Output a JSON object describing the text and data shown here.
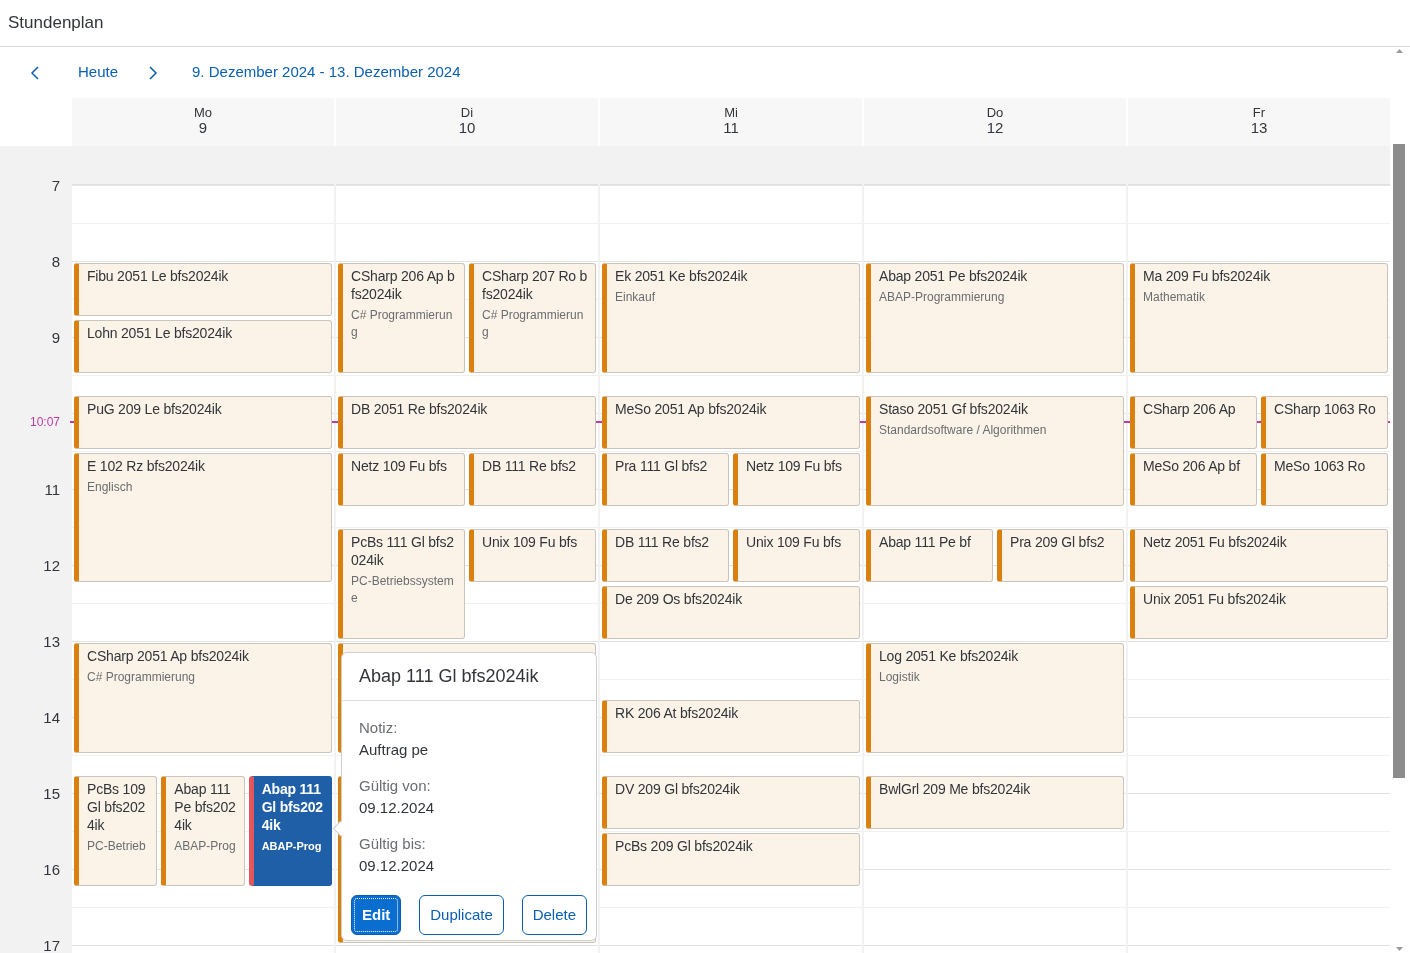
{
  "app": {
    "title": "Stundenplan"
  },
  "toolbar": {
    "today": "Heute",
    "range": "9. Dezember 2024 - 13. Dezember 2024"
  },
  "hours": [
    "7",
    "8",
    "9",
    "11",
    "12",
    "13",
    "14",
    "15",
    "16",
    "17"
  ],
  "now": {
    "label": "10:07"
  },
  "days": [
    {
      "weekday": "Mo",
      "date": "9",
      "groups": [
        {
          "items": [
            {
              "title": "Fibu 2051 Le bfs2024ik",
              "selected": false
            }
          ]
        },
        {
          "items": [
            {
              "title": "Lohn 2051 Le bfs2024ik",
              "selected": false
            }
          ]
        },
        {
          "items": [
            {
              "title": "PuG 209 Le bfs2024ik",
              "selected": false
            }
          ]
        },
        {
          "items": [
            {
              "title": "E 102 Rz bfs2024ik",
              "subtitle": "Englisch",
              "selected": false
            }
          ]
        },
        {
          "items": [
            {
              "title": "CSharp 2051 Ap bfs2024ik",
              "subtitle": "C# Programmierung",
              "selected": false
            }
          ]
        },
        {
          "items": [
            {
              "title": "PcBs 109 Gl bfs2024ik",
              "subtitle": "PC-Betrieb",
              "selected": false
            },
            {
              "title": "Abap 111 Pe bfs2024ik",
              "subtitle": "ABAP-Prog",
              "selected": false
            },
            {
              "title": "Abap 111 Gl bfs2024ik",
              "subtitle": "ABAP-Prog",
              "selected": true
            }
          ]
        }
      ]
    },
    {
      "weekday": "Di",
      "date": "10",
      "groups": [
        {
          "items": [
            {
              "title": "CSharp 206 Ap bfs2024ik",
              "subtitle": "C# Programmierung",
              "selected": false
            },
            {
              "title": "CSharp 207 Ro bfs2024ik",
              "subtitle": "C# Programmierung",
              "selected": false
            }
          ]
        },
        {
          "items": [
            {
              "title": "DB 2051 Re bfs2024ik",
              "selected": false
            }
          ]
        },
        {
          "items": [
            {
              "title": "Netz 109 Fu bfs",
              "selected": false
            },
            {
              "title": "DB 111 Re bfs2",
              "selected": false
            }
          ]
        },
        {
          "items": [
            {
              "title": "PcBs 111 Gl bfs2024ik",
              "subtitle": "PC-Betriebssysteme",
              "selected": false
            },
            {
              "title": "Unix 109 Fu bfs",
              "selected": false
            }
          ]
        },
        {
          "items": [
            {
              "selected": false
            }
          ]
        },
        {
          "items": [
            {
              "selected": false
            }
          ]
        }
      ]
    },
    {
      "weekday": "Mi",
      "date": "11",
      "groups": [
        {
          "items": [
            {
              "title": "Ek 2051 Ke bfs2024ik",
              "subtitle": "Einkauf",
              "selected": false
            }
          ]
        },
        {
          "items": [
            {
              "title": "MeSo 2051 Ap bfs2024ik",
              "selected": false
            }
          ]
        },
        {
          "items": [
            {
              "title": "Pra 111 Gl bfs2",
              "selected": false
            },
            {
              "title": "Netz 109 Fu bfs",
              "selected": false
            }
          ]
        },
        {
          "items": [
            {
              "title": "DB 111 Re bfs2",
              "selected": false
            },
            {
              "title": "Unix 109 Fu bfs",
              "selected": false
            }
          ]
        },
        {
          "items": [
            {
              "title": "De 209 Os bfs2024ik",
              "selected": false
            }
          ]
        },
        {
          "items": [
            {
              "title": "RK 206 At bfs2024ik",
              "selected": false
            }
          ]
        },
        {
          "items": [
            {
              "title": "DV 209 Gl bfs2024ik",
              "selected": false
            }
          ]
        },
        {
          "items": [
            {
              "title": "PcBs 209 Gl bfs2024ik",
              "selected": false
            }
          ]
        }
      ]
    },
    {
      "weekday": "Do",
      "date": "12",
      "groups": [
        {
          "items": [
            {
              "title": "Abap 2051 Pe bfs2024ik",
              "subtitle": "ABAP-Programmierung",
              "selected": false
            }
          ]
        },
        {
          "items": [
            {
              "title": "Staso 2051 Gf bfs2024ik",
              "subtitle": "Standardsoftware / Algorithmen",
              "selected": false
            }
          ]
        },
        {
          "items": [
            {
              "title": "Abap 111 Pe bf",
              "selected": false
            },
            {
              "title": "Pra 209 Gl bfs2",
              "selected": false
            }
          ]
        },
        {
          "items": [
            {
              "title": "Log 2051 Ke bfs2024ik",
              "subtitle": "Logistik",
              "selected": false
            }
          ]
        },
        {
          "items": [
            {
              "title": "BwlGrl 209 Me bfs2024ik",
              "selected": false
            }
          ]
        }
      ]
    },
    {
      "weekday": "Fr",
      "date": "13",
      "groups": [
        {
          "items": [
            {
              "title": "Ma 209 Fu bfs2024ik",
              "subtitle": "Mathematik",
              "selected": false
            }
          ]
        },
        {
          "items": [
            {
              "title": "CSharp 206 Ap",
              "selected": false
            },
            {
              "title": "CSharp 1063 Ro",
              "selected": false
            }
          ]
        },
        {
          "items": [
            {
              "title": "MeSo 206 Ap bf",
              "selected": false
            },
            {
              "title": "MeSo 1063 Ro",
              "selected": false
            }
          ]
        },
        {
          "items": [
            {
              "title": "Netz 2051 Fu bfs2024ik",
              "selected": false
            }
          ]
        },
        {
          "items": [
            {
              "title": "Unix 2051 Fu bfs2024ik",
              "selected": false
            }
          ]
        }
      ]
    }
  ],
  "popover": {
    "title": "Abap 111 Gl bfs2024ik",
    "fields": [
      {
        "label": "Notiz:",
        "value": "Auftrag pe"
      },
      {
        "label": "Gültig von:",
        "value": "09.12.2024"
      },
      {
        "label": "Gültig bis:",
        "value": "09.12.2024"
      }
    ],
    "buttons": [
      {
        "label": "Edit",
        "selected": true
      },
      {
        "label": "Duplicate",
        "selected": false
      },
      {
        "label": "Delete",
        "selected": false
      }
    ]
  }
}
